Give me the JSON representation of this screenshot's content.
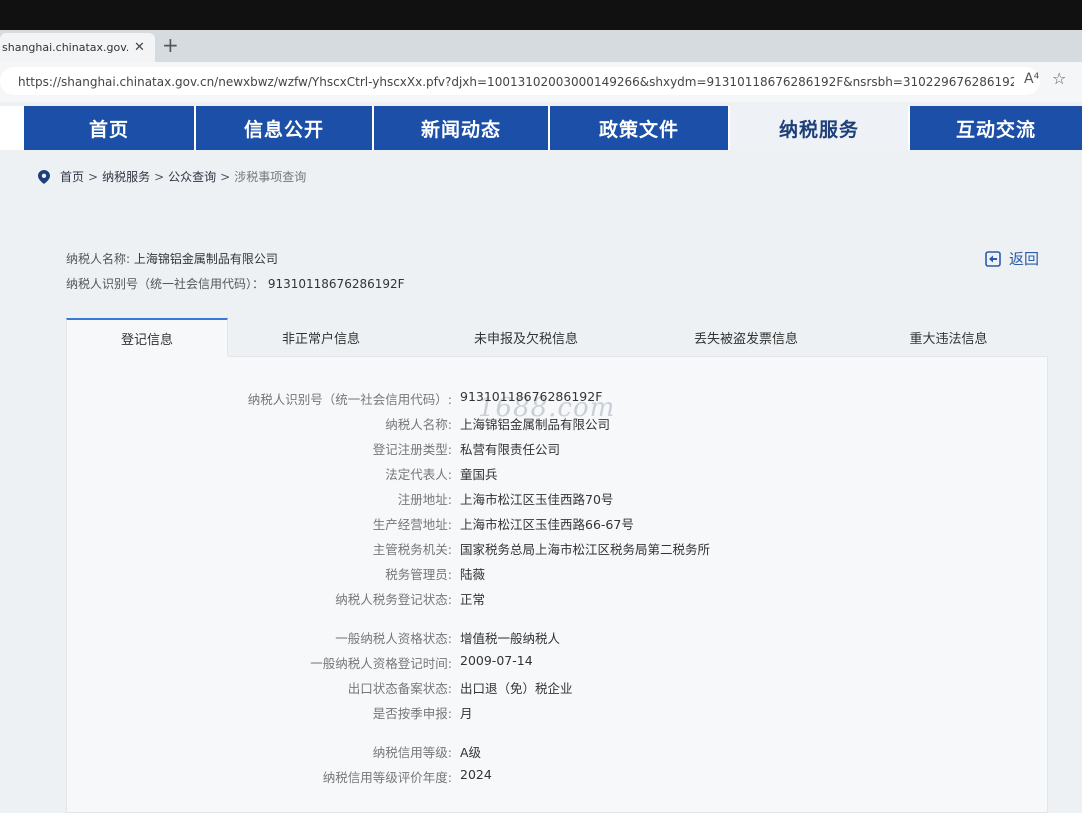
{
  "browser": {
    "tab_title": "shanghai.chinatax.gov.cn/newxbw",
    "tab_close": "✕",
    "new_tab": "+",
    "url": "https://shanghai.chinatax.gov.cn/newxbwz/wzfw/YhscxCtrl-yhscxXx.pfv?djxh=10013102003000149266&shxydm=91310118676286192F&nsrsbh=310229676286192&nsrmc=上海锦铝金...",
    "reader_icon": "A⁴",
    "star_icon": "☆"
  },
  "nav": {
    "items": [
      "首页",
      "信息公开",
      "新闻动态",
      "政策文件",
      "纳税服务",
      "互动交流"
    ],
    "active_index": 4
  },
  "breadcrumb": {
    "items": [
      "首页",
      "纳税服务",
      "公众查询"
    ],
    "current": "涉税事项查询",
    "separator": ">"
  },
  "taxpayer": {
    "name_label": "纳税人名称:",
    "name": "上海锦铝金属制品有限公司",
    "id_label": "纳税人识别号（统一社会信用代码）：",
    "id": "91310118676286192F"
  },
  "back_label": "返回",
  "tabs": [
    "登记信息",
    "非正常户信息",
    "未申报及欠税信息",
    "丢失被盗发票信息",
    "重大违法信息"
  ],
  "active_tab": 0,
  "watermark": "1688.com",
  "details": {
    "group1": [
      {
        "label": "纳税人识别号（统一社会信用代码）:",
        "value": "91310118676286192F"
      },
      {
        "label": "纳税人名称:",
        "value": "上海锦铝金属制品有限公司"
      },
      {
        "label": "登记注册类型:",
        "value": "私营有限责任公司"
      },
      {
        "label": "法定代表人:",
        "value": "童国兵"
      },
      {
        "label": "注册地址:",
        "value": "上海市松江区玉佳西路70号"
      },
      {
        "label": "生产经营地址:",
        "value": "上海市松江区玉佳西路66-67号"
      },
      {
        "label": "主管税务机关:",
        "value": "国家税务总局上海市松江区税务局第二税务所"
      },
      {
        "label": "税务管理员:",
        "value": "陆薇"
      },
      {
        "label": "纳税人税务登记状态:",
        "value": "正常"
      }
    ],
    "group2": [
      {
        "label": "一般纳税人资格状态:",
        "value": "增值税一般纳税人"
      },
      {
        "label": "一般纳税人资格登记时间:",
        "value": "2009-07-14"
      },
      {
        "label": "出口状态备案状态:",
        "value": "出口退（免）税企业"
      },
      {
        "label": "是否按季申报:",
        "value": "月"
      }
    ],
    "group3": [
      {
        "label": "纳税信用等级:",
        "value": "A级"
      },
      {
        "label": "纳税信用等级评价年度:",
        "value": "2024"
      }
    ]
  }
}
